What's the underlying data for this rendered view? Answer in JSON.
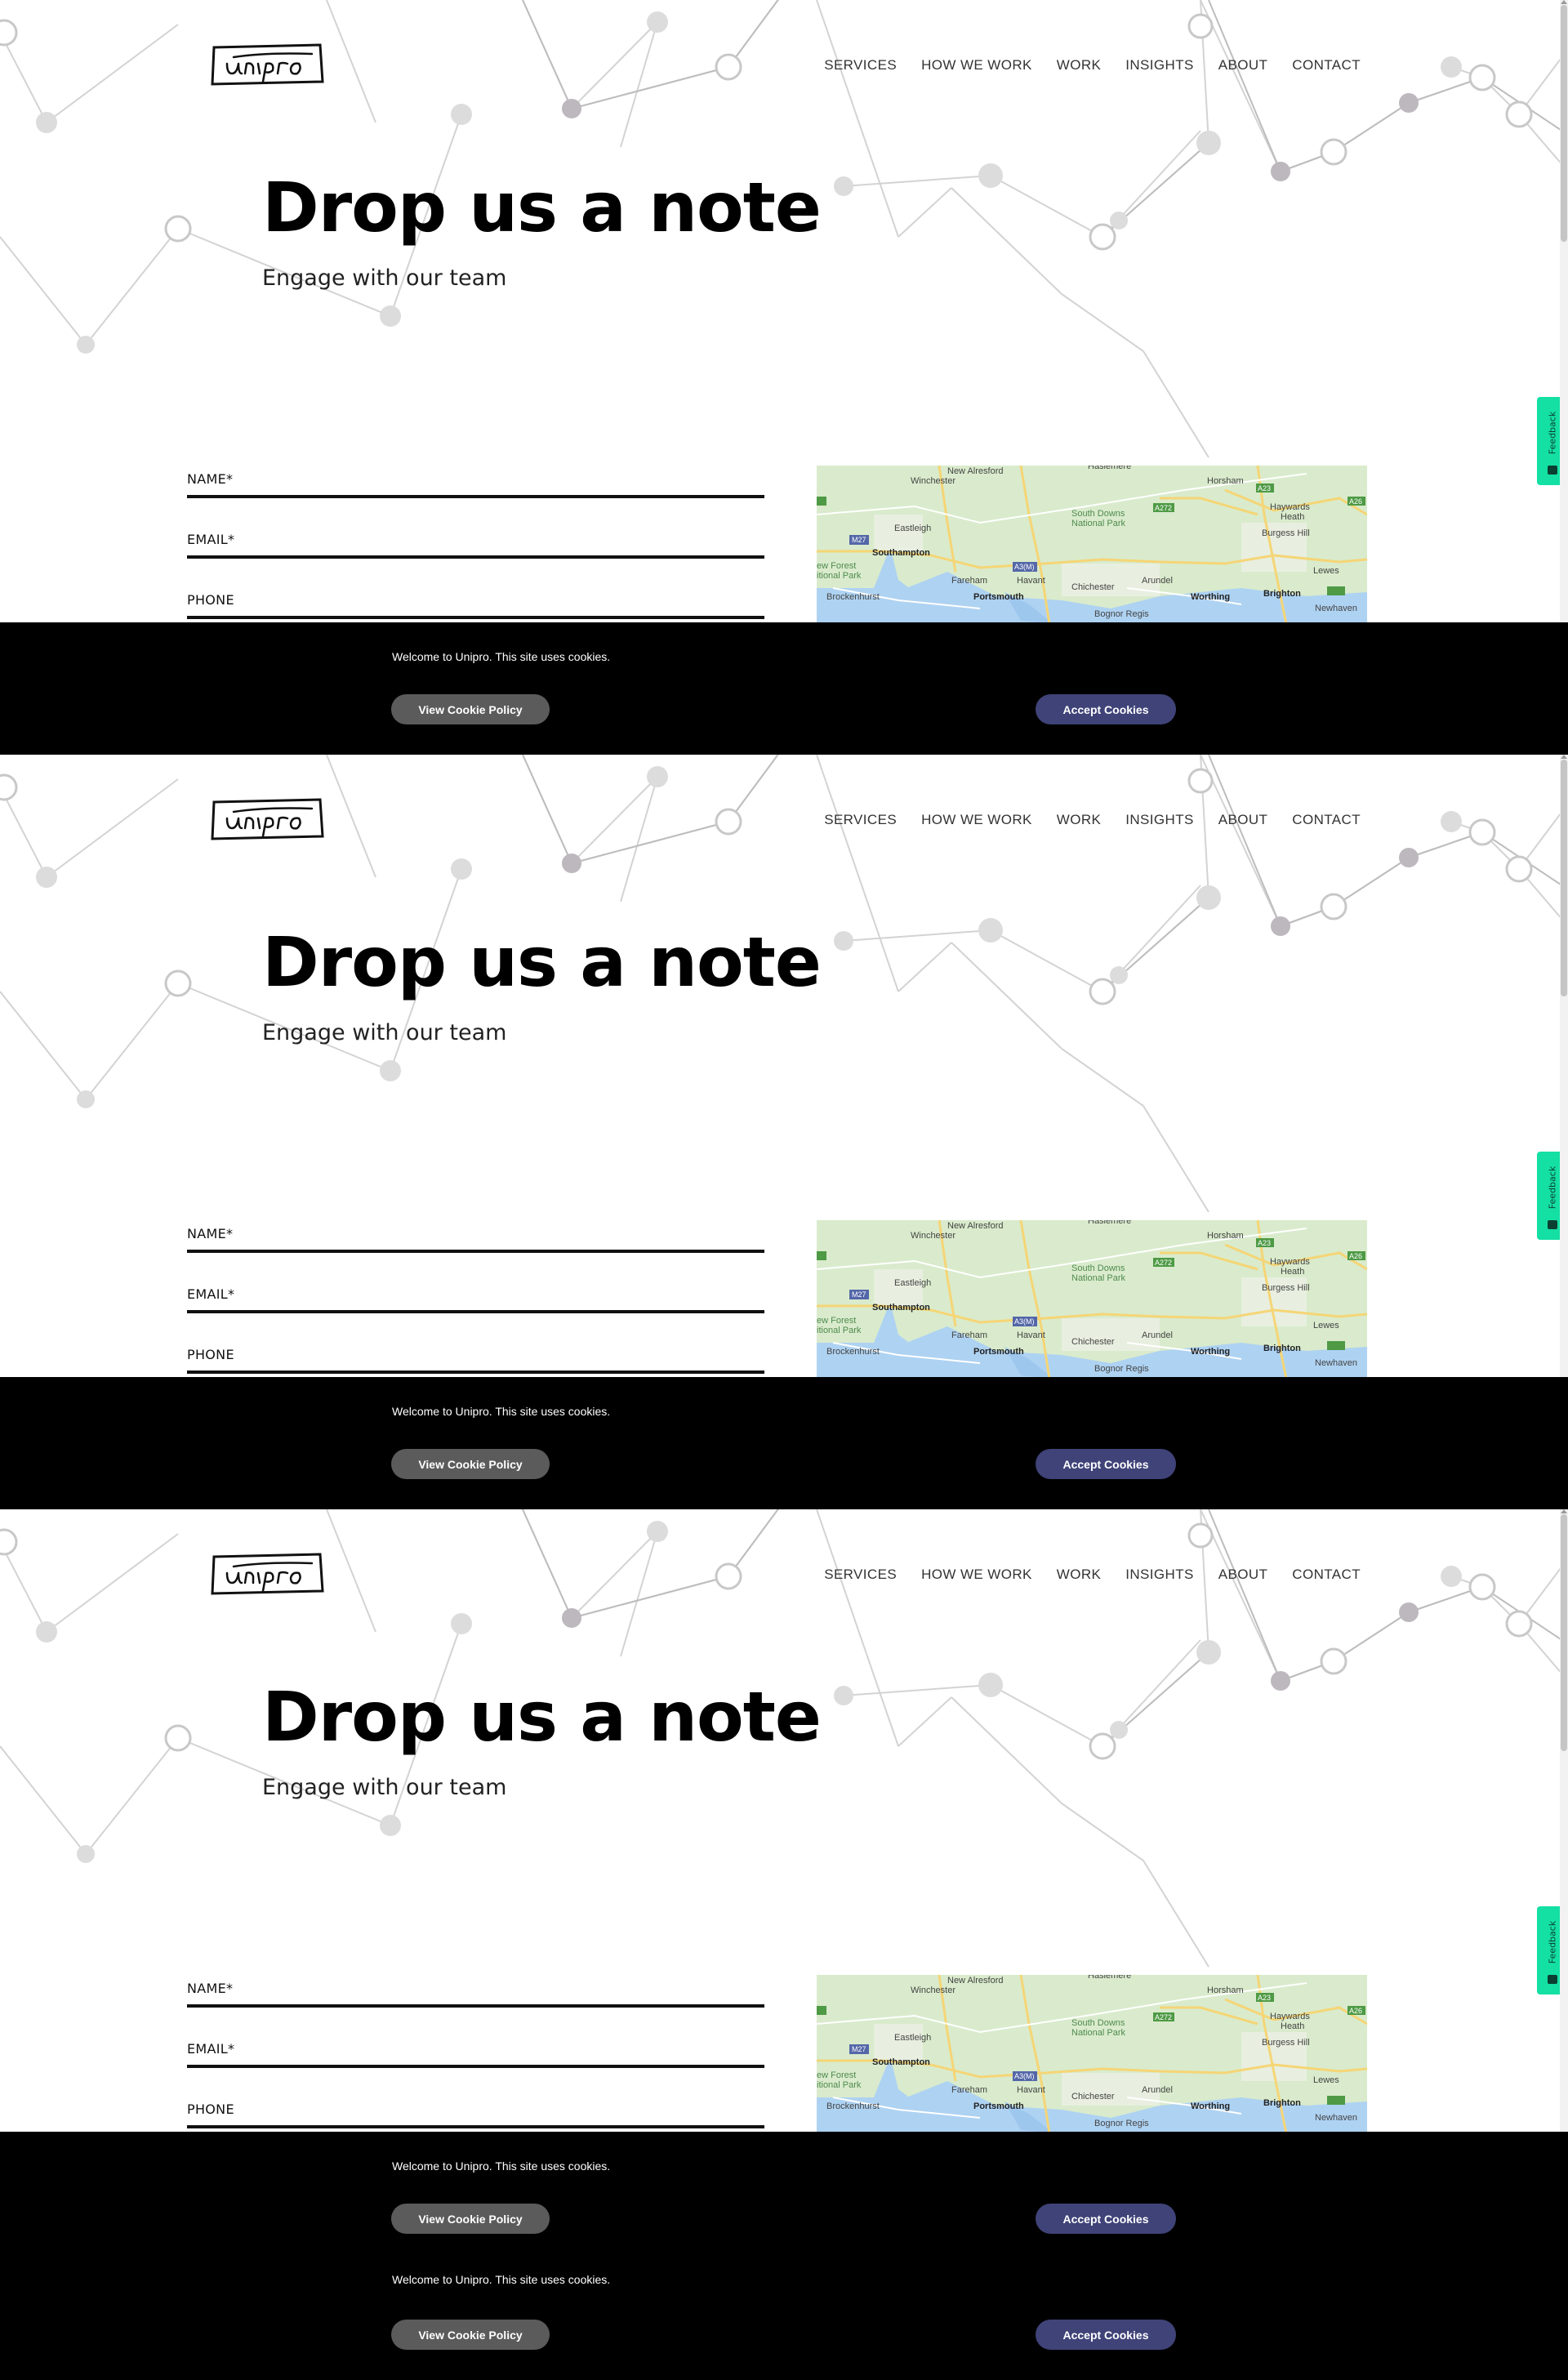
{
  "brand": {
    "logo_text": "unipro"
  },
  "nav": [
    {
      "label": "SERVICES"
    },
    {
      "label": "HOW WE WORK"
    },
    {
      "label": "WORK"
    },
    {
      "label": "INSIGHTS"
    },
    {
      "label": "ABOUT"
    },
    {
      "label": "CONTACT"
    }
  ],
  "hero": {
    "title": "Drop us a note",
    "subtitle": "Engage with our team"
  },
  "form": {
    "name_label": "NAME*",
    "email_label": "EMAIL*",
    "phone_label": "PHONE"
  },
  "map": {
    "places": [
      "New Alresford",
      "Haslemere",
      "Winchester",
      "Horsham",
      "Haywards Heath",
      "South Downs National Park",
      "Eastleigh",
      "Burgess Hill",
      "Southampton",
      "New Forest National Park",
      "Fareham",
      "Havant",
      "Chichester",
      "Arundel",
      "Lewes",
      "Brockenhurst",
      "Portsmouth",
      "Worthing",
      "Brighton",
      "Bognor Regis",
      "Newhaven"
    ],
    "roads": [
      "M27",
      "A3(M)",
      "A272",
      "A23",
      "A26"
    ]
  },
  "feedback": {
    "label": "Feedback"
  },
  "cookie": {
    "message": "Welcome to Unipro. This site uses cookies.",
    "policy_label": "View Cookie Policy",
    "accept_label": "Accept Cookies"
  },
  "colors": {
    "accept_button": "#3f4378",
    "policy_button": "#5b5b5b",
    "feedback_tab": "#14e0a4",
    "cookie_banner": "#000000"
  }
}
